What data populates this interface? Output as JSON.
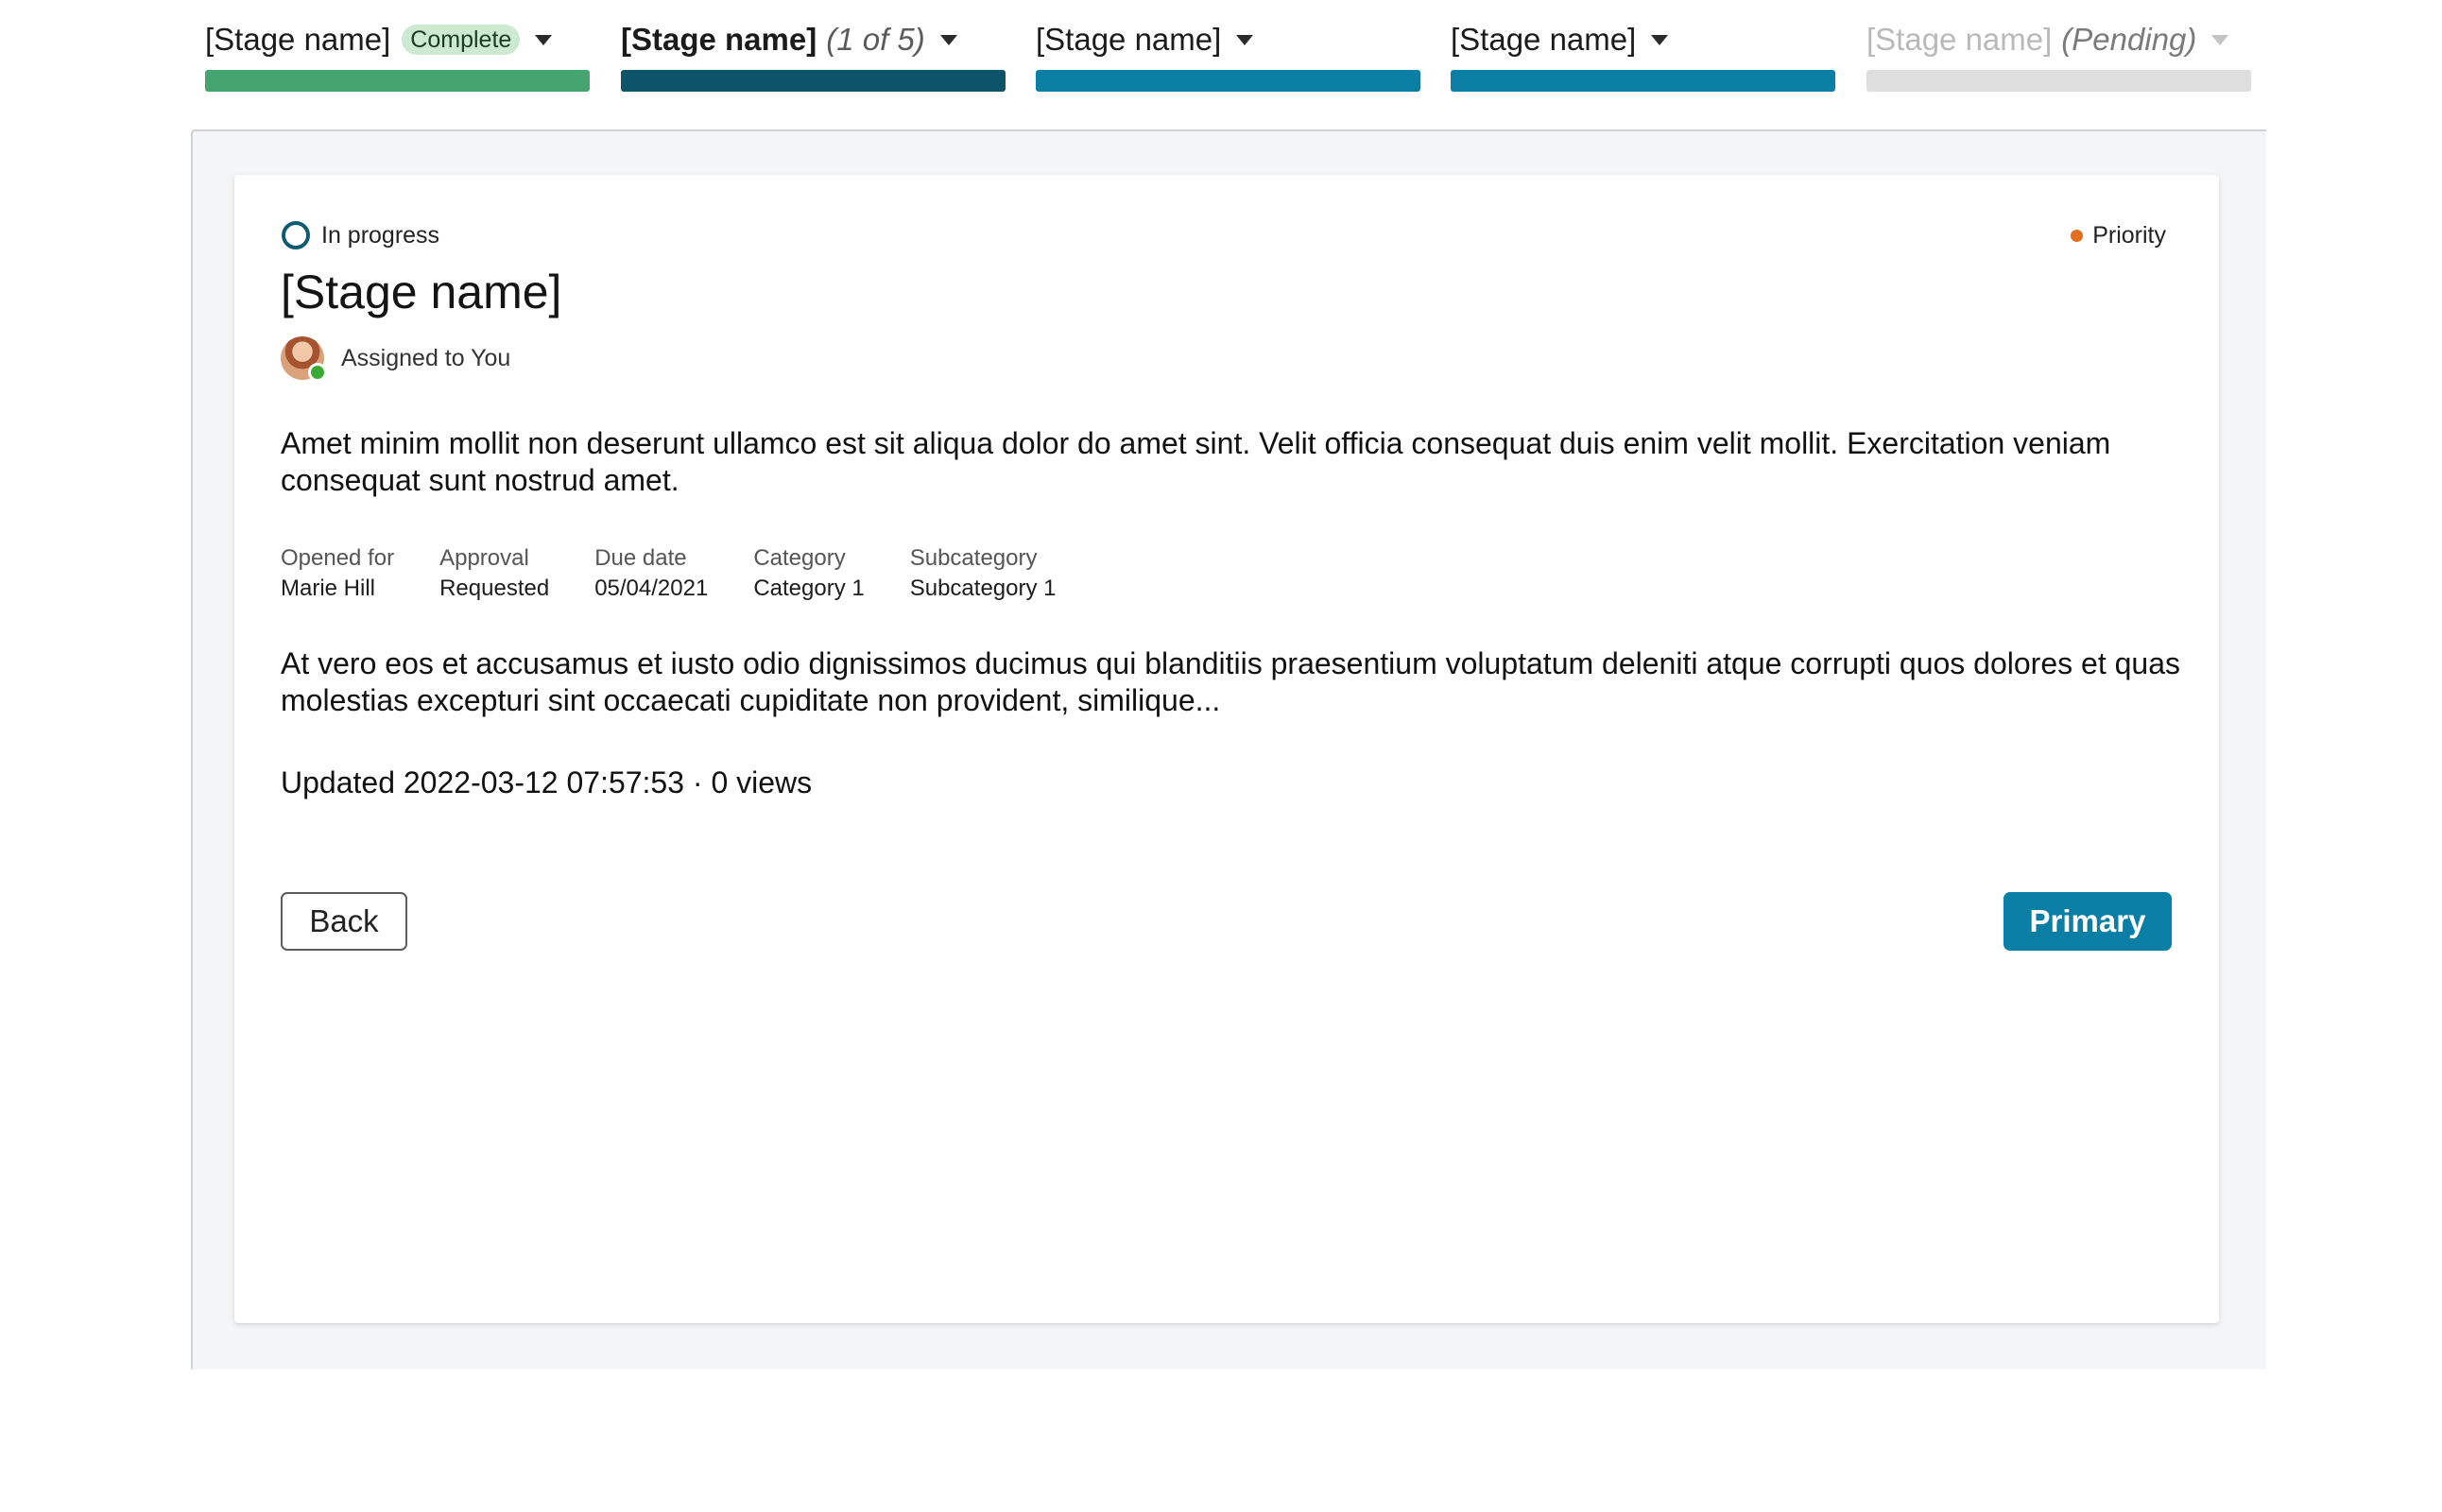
{
  "stages": [
    {
      "name": "[Stage name]",
      "badge": "Complete",
      "extra": "",
      "bar_color": "#44a56e",
      "state": "complete"
    },
    {
      "name": "[Stage name]",
      "badge": "",
      "extra": "(1 of 5)",
      "bar_color": "#0d546b",
      "state": "current"
    },
    {
      "name": "[Stage name]",
      "badge": "",
      "extra": "",
      "bar_color": "#0b7fa3",
      "state": "upcoming"
    },
    {
      "name": "[Stage name]",
      "badge": "",
      "extra": "",
      "bar_color": "#0b7fa3",
      "state": "upcoming"
    },
    {
      "name": "[Stage name]",
      "badge": "",
      "extra": "(Pending)",
      "bar_color": "#dedede",
      "state": "pending"
    }
  ],
  "card": {
    "status": "In progress",
    "priority": {
      "label": "Priority",
      "color": "#e06f1f"
    },
    "title": "[Stage name]",
    "assigned": "Assigned to You",
    "description": "Amet minim mollit non deserunt ullamco est sit aliqua dolor do amet sint. Velit officia consequat duis enim velit mollit. Exercitation veniam consequat sunt nostrud amet.",
    "meta": [
      {
        "label": "Opened for",
        "value": "Marie Hill"
      },
      {
        "label": "Approval",
        "value": "Requested"
      },
      {
        "label": "Due date",
        "value": "05/04/2021"
      },
      {
        "label": "Category",
        "value": "Category 1"
      },
      {
        "label": "Subcategory",
        "value": "Subcategory 1"
      }
    ],
    "description2": "At vero eos et accusamus et iusto odio dignissimos ducimus qui blanditiis praesentium voluptatum deleniti atque corrupti quos dolores et quas molestias excepturi sint occaecati cupiditate non provident, similique...",
    "updated": "Updated 2022-03-12 07:57:53 · 0 views",
    "back_label": "Back",
    "primary_label": "Primary"
  }
}
